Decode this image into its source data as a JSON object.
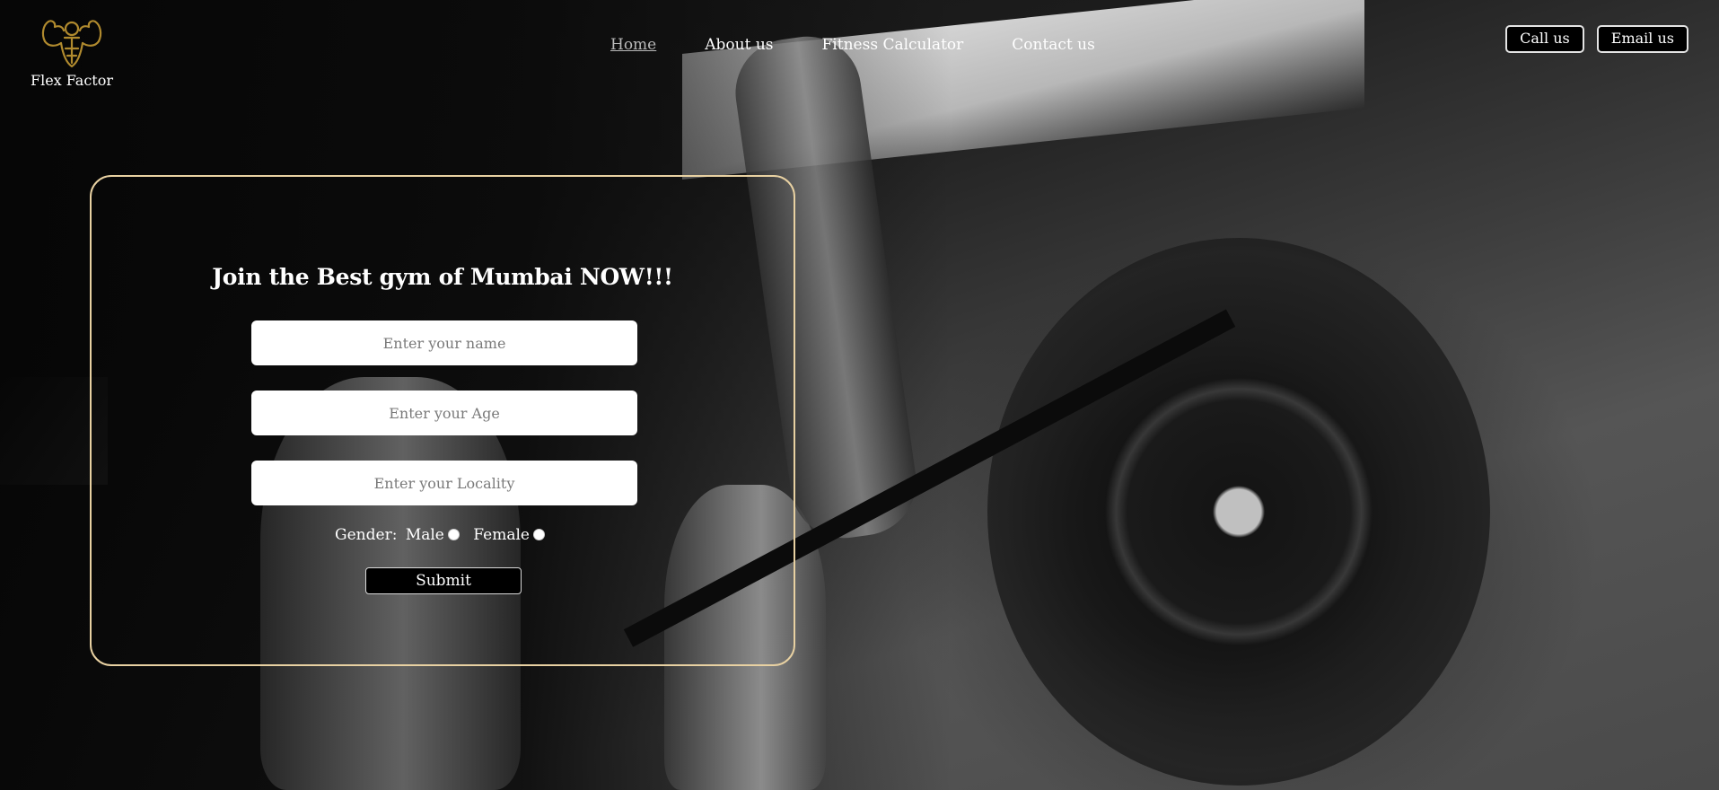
{
  "brand": {
    "name": "Flex Factor",
    "logo_icon": "muscle-man-icon",
    "logo_color": "#b08a2e"
  },
  "nav": {
    "items": [
      {
        "label": "Home",
        "active": true
      },
      {
        "label": "About us",
        "active": false
      },
      {
        "label": "Fitness Calculator",
        "active": false
      },
      {
        "label": "Contact us",
        "active": false
      }
    ]
  },
  "header_actions": {
    "call_label": "Call us",
    "email_label": "Email us"
  },
  "form": {
    "title": "Join the Best gym of Mumbai NOW!!!",
    "name_placeholder": "Enter your name",
    "age_placeholder": "Enter your Age",
    "locality_placeholder": "Enter your Locality",
    "gender_label": "Gender:",
    "gender_options": [
      "Male",
      "Female"
    ],
    "submit_label": "Submit",
    "border_color": "#e8d1a2"
  }
}
